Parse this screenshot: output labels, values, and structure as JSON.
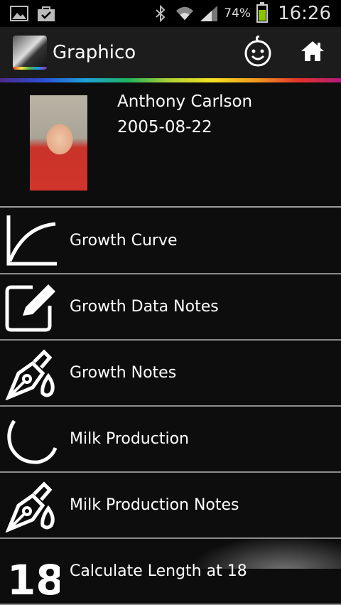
{
  "status_bar": {
    "battery": "74%",
    "time": "16:26"
  },
  "app": {
    "title": "Graphico"
  },
  "profile": {
    "name": "Anthony Carlson",
    "birthdate": "2005-08-22"
  },
  "menu": {
    "items": [
      {
        "label": "Growth Curve",
        "icon": "growth-curve-icon"
      },
      {
        "label": "Growth Data Notes",
        "icon": "edit-note-icon"
      },
      {
        "label": "Growth Notes",
        "icon": "pen-drops-icon"
      },
      {
        "label": "Milk Production",
        "icon": "arc-icon"
      },
      {
        "label": "Milk Production Notes",
        "icon": "pen-drops-icon"
      },
      {
        "label": "Calculate Length at 18",
        "icon": "eighteen-icon"
      }
    ]
  },
  "colors": {
    "accent_battery": "#8ac600",
    "background": "#0d0d0d"
  }
}
